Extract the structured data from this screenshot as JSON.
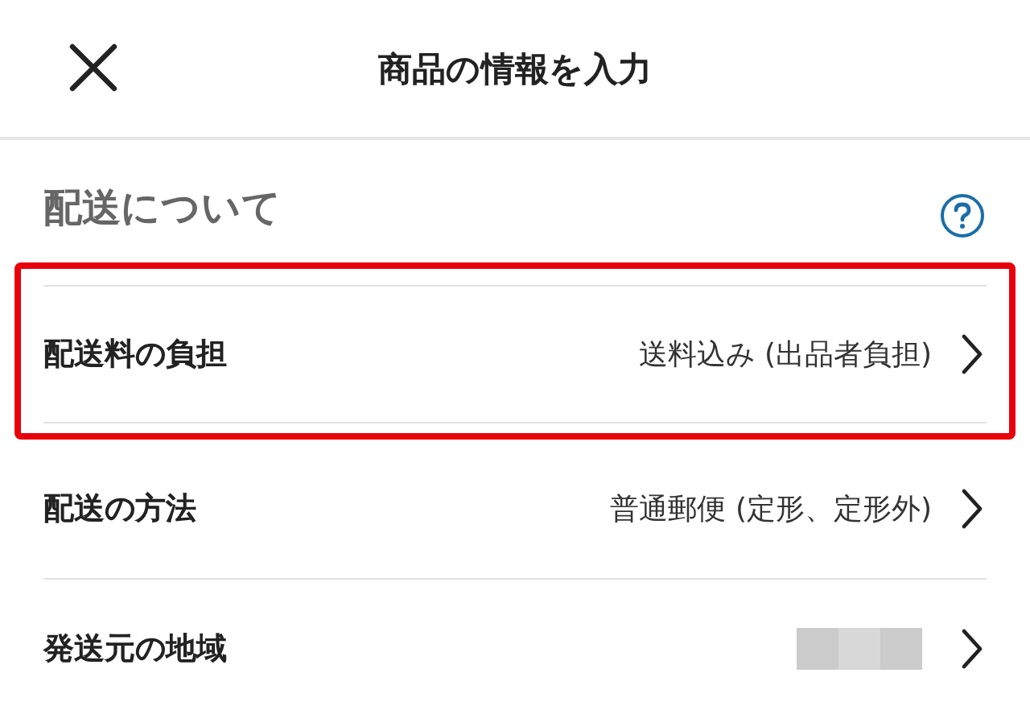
{
  "header": {
    "title": "商品の情報を入力"
  },
  "section": {
    "title": "配送について"
  },
  "rows": [
    {
      "label": "配送料の負担",
      "kind": "text",
      "value": "送料込み (出品者負担)",
      "highlighted": true
    },
    {
      "label": "配送の方法",
      "kind": "text",
      "value": "普通郵便 (定形、定形外)",
      "highlighted": false
    },
    {
      "label": "発送元の地域",
      "kind": "redacted",
      "highlighted": false
    }
  ]
}
